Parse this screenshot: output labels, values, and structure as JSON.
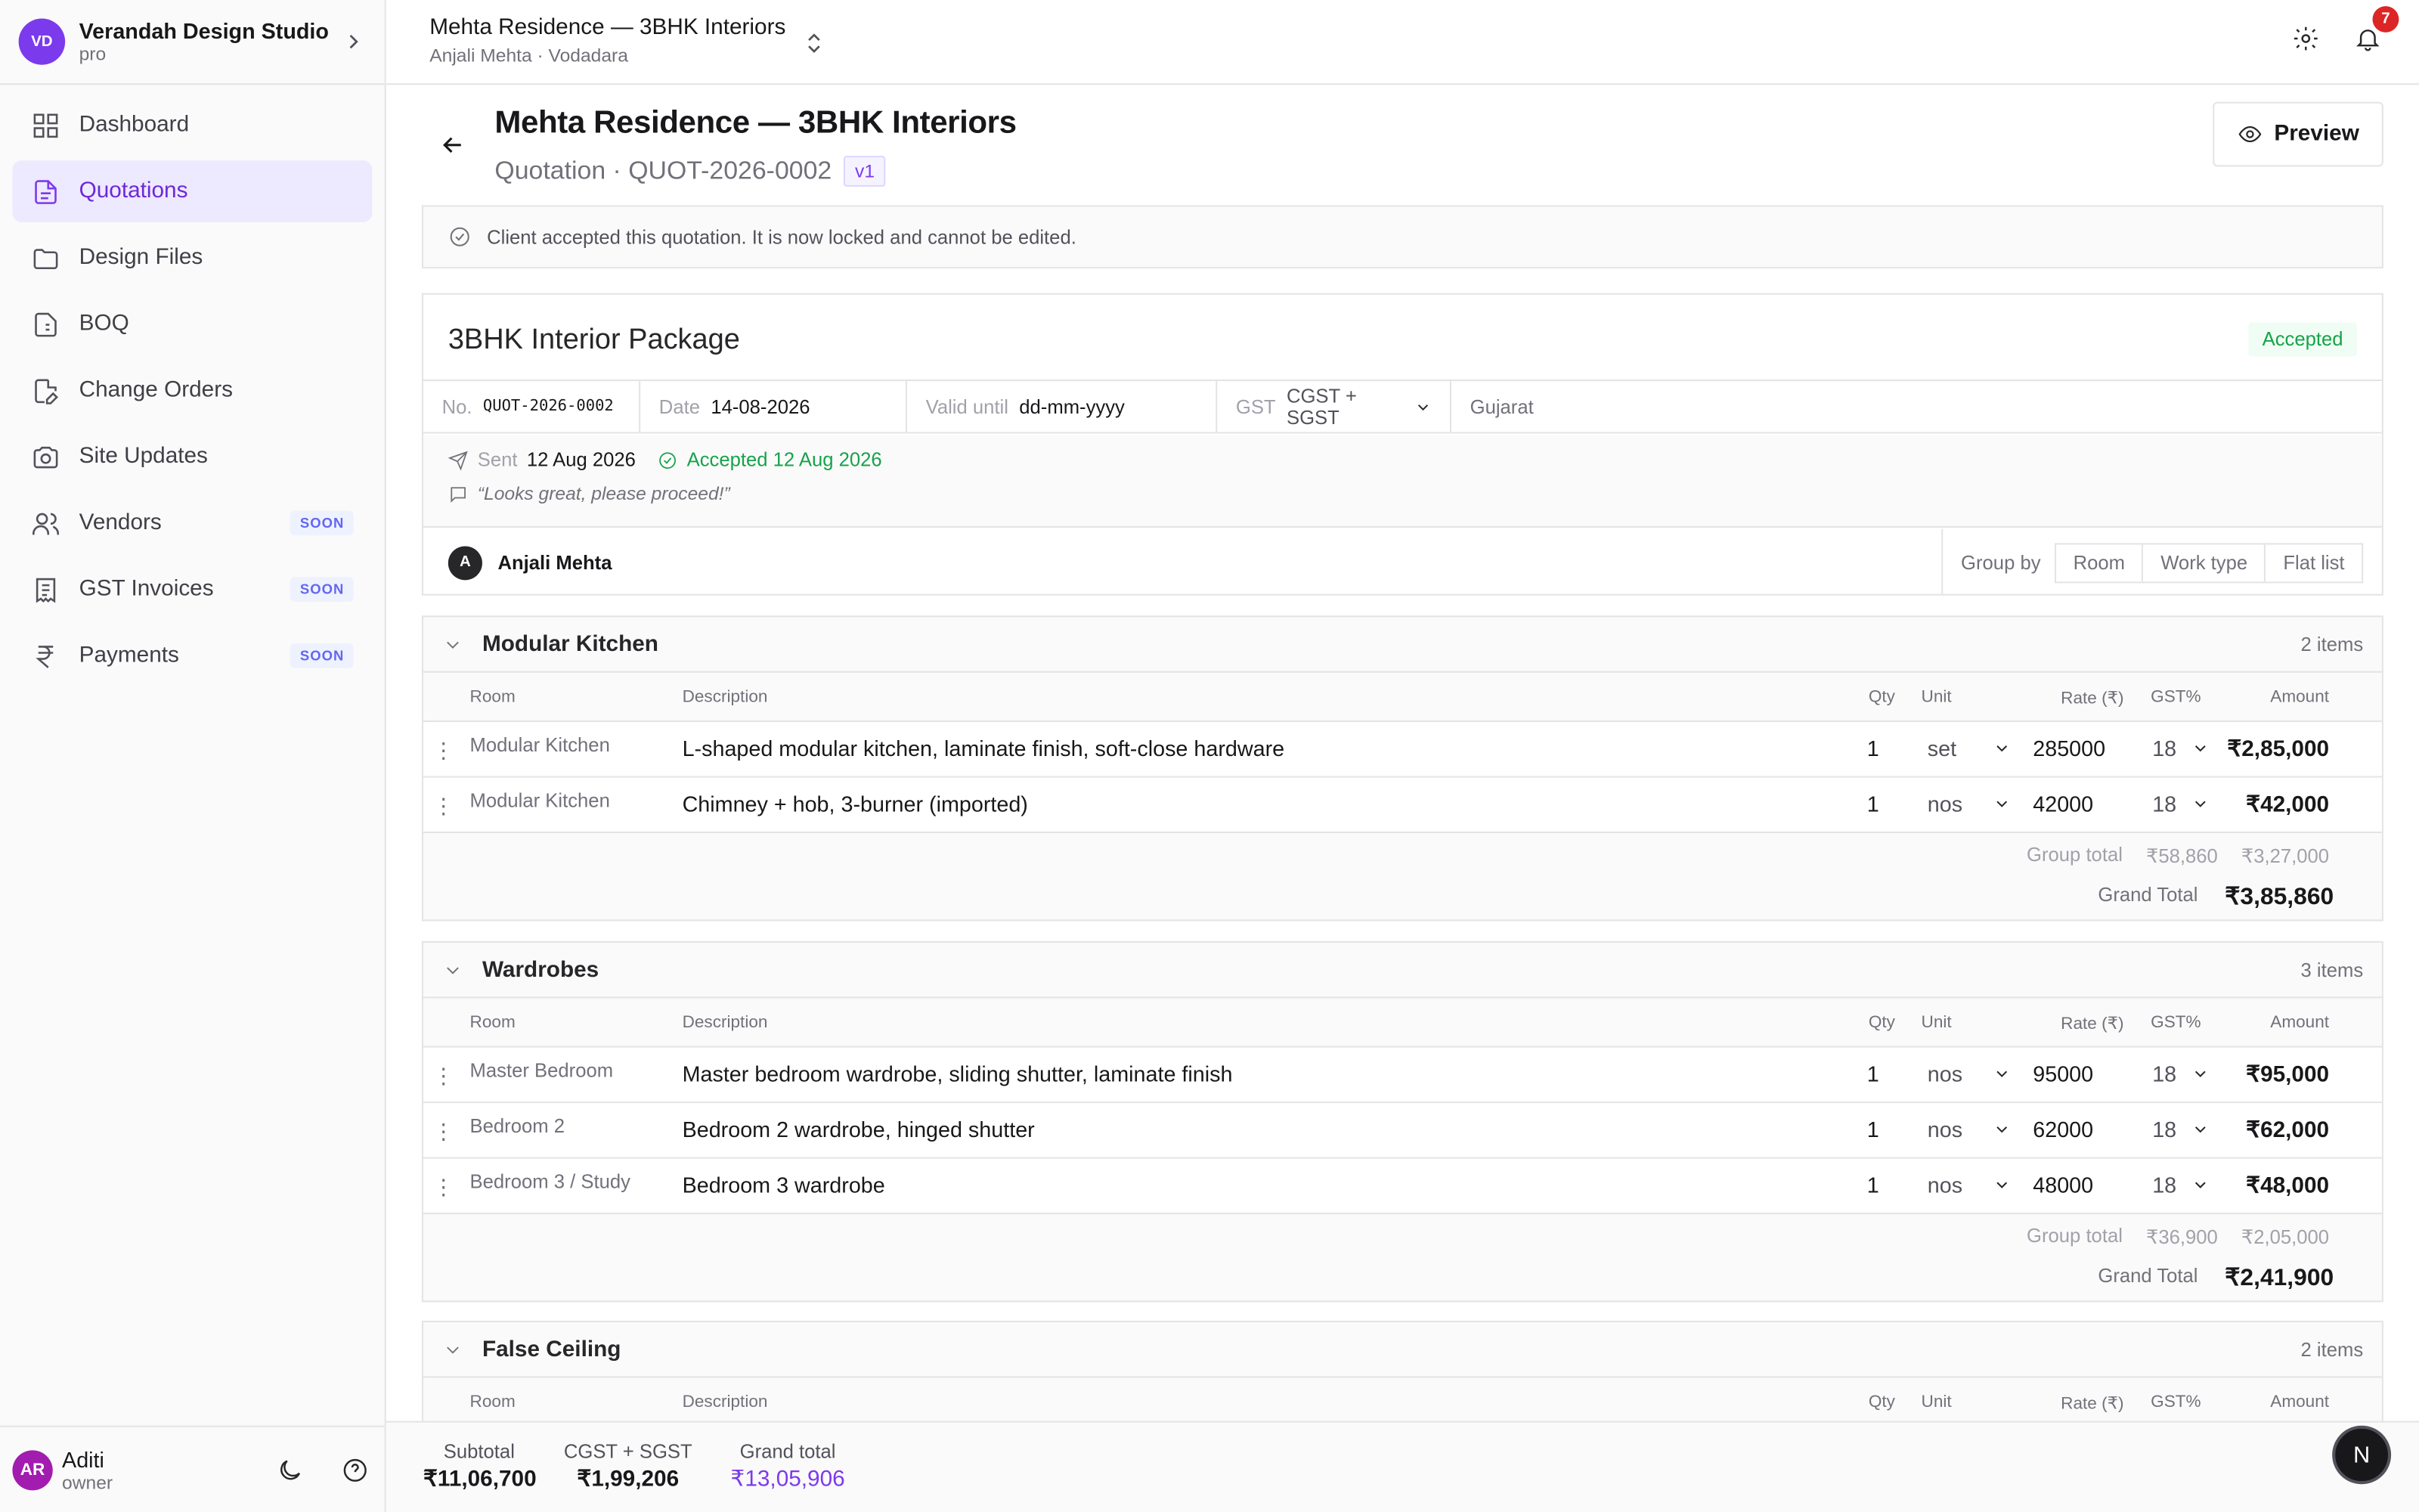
{
  "workspace": {
    "initials": "VD",
    "name": "Verandah Design Studio",
    "plan": "pro"
  },
  "nav": [
    {
      "label": "Dashboard",
      "icon": "dashboard-icon"
    },
    {
      "label": "Quotations",
      "icon": "quotation-icon",
      "active": true
    },
    {
      "label": "Design Files",
      "icon": "folder-icon"
    },
    {
      "label": "BOQ",
      "icon": "boq-icon"
    },
    {
      "label": "Change Orders",
      "icon": "change-order-icon"
    },
    {
      "label": "Site Updates",
      "icon": "camera-icon"
    },
    {
      "label": "Vendors",
      "icon": "users-icon",
      "badge": "SOON"
    },
    {
      "label": "GST Invoices",
      "icon": "invoice-icon",
      "badge": "SOON"
    },
    {
      "label": "Payments",
      "icon": "rupee-icon",
      "badge": "SOON"
    }
  ],
  "user": {
    "initials": "AR",
    "name": "Aditi",
    "role": "owner"
  },
  "topbar": {
    "project": "Mehta Residence — 3BHK Interiors",
    "client": "Anjali Mehta · Vodadara",
    "notifications": "7"
  },
  "page": {
    "title": "Mehta Residence — 3BHK Interiors",
    "subtitle": "Quotation · QUOT-2026-0002",
    "version": "v1",
    "preview": "Preview",
    "notice": "Client accepted this quotation. It is now locked and cannot be edited."
  },
  "card": {
    "title": "3BHK Interior Package",
    "status": "Accepted",
    "no_label": "No.",
    "no": "QUOT-2026-0002",
    "date_label": "Date",
    "date": "14-08-2026",
    "valid_label": "Valid until",
    "valid": "dd-mm-yyyy",
    "gst_label": "GST",
    "gst": "CGST + SGST",
    "state": "Gujarat",
    "sent_label": "Sent",
    "sent": "12 Aug 2026",
    "accepted": "Accepted 12 Aug 2026",
    "comment": "“Looks great, please proceed!”",
    "client_initial": "A",
    "client": "Anjali Mehta",
    "groupby_label": "Group by",
    "groupby": [
      "Room",
      "Work type",
      "Flat list"
    ]
  },
  "headers": {
    "room": "Room",
    "desc": "Description",
    "qty": "Qty",
    "unit": "Unit",
    "rate": "Rate (₹)",
    "gst": "GST%",
    "amount": "Amount"
  },
  "groups": [
    {
      "title": "Modular Kitchen",
      "count": "2 items",
      "rows": [
        {
          "room": "Modular Kitchen",
          "desc": "L-shaped modular kitchen, laminate finish, soft-close hardware",
          "qty": "1",
          "unit": "set",
          "rate": "285000",
          "gst": "18",
          "amount": "₹2,85,000"
        },
        {
          "room": "Modular Kitchen",
          "desc": "Chimney + hob, 3-burner (imported)",
          "qty": "1",
          "unit": "nos",
          "rate": "42000",
          "gst": "18",
          "amount": "₹42,000"
        }
      ],
      "total_label": "Group total",
      "gst_total": "₹58,860",
      "subtotal": "₹3,27,000",
      "grand_label": "Grand Total",
      "grand": "₹3,85,860"
    },
    {
      "title": "Wardrobes",
      "count": "3 items",
      "rows": [
        {
          "room": "Master Bedroom",
          "desc": "Master bedroom wardrobe, sliding shutter, laminate finish",
          "qty": "1",
          "unit": "nos",
          "rate": "95000",
          "gst": "18",
          "amount": "₹95,000"
        },
        {
          "room": "Bedroom 2",
          "desc": "Bedroom 2 wardrobe, hinged shutter",
          "qty": "1",
          "unit": "nos",
          "rate": "62000",
          "gst": "18",
          "amount": "₹62,000"
        },
        {
          "room": "Bedroom 3 / Study",
          "desc": "Bedroom 3 wardrobe",
          "qty": "1",
          "unit": "nos",
          "rate": "48000",
          "gst": "18",
          "amount": "₹48,000"
        }
      ],
      "total_label": "Group total",
      "gst_total": "₹36,900",
      "subtotal": "₹2,05,000",
      "grand_label": "Grand Total",
      "grand": "₹2,41,900"
    },
    {
      "title": "False Ceiling",
      "count": "2 items"
    }
  ],
  "footer": {
    "subtotal_label": "Subtotal",
    "subtotal": "₹11,06,700",
    "gst_label": "CGST + SGST",
    "gst": "₹1,99,206",
    "grand_label": "Grand total",
    "grand": "₹13,05,906"
  },
  "fab": "N"
}
